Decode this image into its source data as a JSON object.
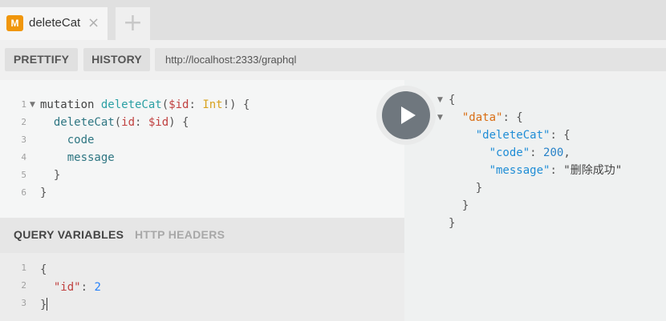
{
  "tabs": {
    "active": {
      "badge": "M",
      "title": "deleteCat",
      "close": "×"
    },
    "add_label": "+"
  },
  "toolbar": {
    "prettify_label": "PRETTIFY",
    "history_label": "HISTORY",
    "endpoint_url": "http://localhost:2333/graphql"
  },
  "editor": {
    "line_numbers": [
      "1",
      "2",
      "3",
      "4",
      "5",
      "6"
    ],
    "lines": [
      [
        {
          "t": "mutation ",
          "c": "kw"
        },
        {
          "t": "deleteCat",
          "c": "def"
        },
        {
          "t": "(",
          "c": "punc"
        },
        {
          "t": "$id",
          "c": "var"
        },
        {
          "t": ": ",
          "c": "punc"
        },
        {
          "t": "Int",
          "c": "type"
        },
        {
          "t": "!",
          "c": "punc"
        },
        {
          "t": ") {",
          "c": "punc"
        }
      ],
      [
        {
          "t": "  deleteCat",
          "c": "field"
        },
        {
          "t": "(",
          "c": "punc"
        },
        {
          "t": "id",
          "c": "attr"
        },
        {
          "t": ": ",
          "c": "punc"
        },
        {
          "t": "$id",
          "c": "var"
        },
        {
          "t": ") {",
          "c": "punc"
        }
      ],
      [
        {
          "t": "    code",
          "c": "field"
        }
      ],
      [
        {
          "t": "    message",
          "c": "field"
        }
      ],
      [
        {
          "t": "  }",
          "c": "punc"
        }
      ],
      [
        {
          "t": "}",
          "c": "punc"
        }
      ]
    ]
  },
  "variables_panel": {
    "tab_active": "QUERY VARIABLES",
    "tab_inactive": "HTTP HEADERS",
    "line_numbers": [
      "1",
      "2",
      "3"
    ],
    "lines": [
      [
        {
          "t": "{",
          "c": "punc"
        }
      ],
      [
        {
          "t": "  \"id\"",
          "c": "key"
        },
        {
          "t": ": ",
          "c": "punc"
        },
        {
          "t": "2",
          "c": "num"
        }
      ],
      [
        {
          "t": "}",
          "c": "punc"
        }
      ]
    ]
  },
  "results": {
    "lines": [
      [
        {
          "t": "{",
          "c": "punc"
        }
      ],
      [
        {
          "t": "  \"data\"",
          "c": "key-data"
        },
        {
          "t": ": {",
          "c": "punc"
        }
      ],
      [
        {
          "t": "    \"deleteCat\"",
          "c": "key-dc"
        },
        {
          "t": ": {",
          "c": "punc"
        }
      ],
      [
        {
          "t": "      \"code\"",
          "c": "key-code"
        },
        {
          "t": ": ",
          "c": "punc"
        },
        {
          "t": "200",
          "c": "num"
        },
        {
          "t": ",",
          "c": "punc"
        }
      ],
      [
        {
          "t": "      \"message\"",
          "c": "key-msg"
        },
        {
          "t": ": ",
          "c": "punc"
        },
        {
          "t": "\"删除成功\"",
          "c": "str"
        }
      ],
      [
        {
          "t": "    }",
          "c": "punc"
        }
      ],
      [
        {
          "t": "  }",
          "c": "punc"
        }
      ],
      [
        {
          "t": "}",
          "c": "punc"
        }
      ]
    ],
    "fold_markers": [
      "▼",
      "▼"
    ]
  },
  "icons": {
    "tab_badge": "graphql-m-icon",
    "close": "close-icon",
    "add": "plus-icon",
    "run": "play-icon",
    "fold": "fold-arrow-icon"
  }
}
